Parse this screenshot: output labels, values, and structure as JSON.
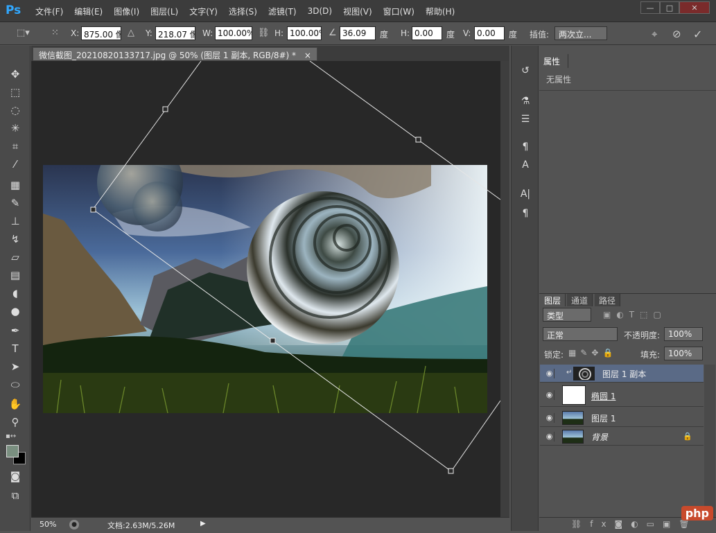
{
  "app": {
    "logo": "Ps"
  },
  "menu": [
    "文件(F)",
    "编辑(E)",
    "图像(I)",
    "图层(L)",
    "文字(Y)",
    "选择(S)",
    "滤镜(T)",
    "3D(D)",
    "视图(V)",
    "窗口(W)",
    "帮助(H)"
  ],
  "window_controls": {
    "minimize": "—",
    "maximize": "□",
    "close": "✕"
  },
  "options": {
    "x_label": "X:",
    "x_value": "875.00 像",
    "y_label": "Y:",
    "y_value": "218.07 像",
    "w_label": "W:",
    "w_value": "100.00%",
    "h_label": "H:",
    "h_value": "100.00%",
    "angle_value": "36.09",
    "angle_unit": "度",
    "hskew_label": "H:",
    "hskew_value": "0.00",
    "hskew_unit": "度",
    "vskew_label": "V:",
    "vskew_value": "0.00",
    "vskew_unit": "度",
    "interp_label": "插值:",
    "interp_value": "两次立..."
  },
  "document": {
    "tab_title": "微信截图_20210820133717.jpg @ 50% (图层 1 副本, RGB/8#) *",
    "tab_close": "×"
  },
  "status": {
    "zoom": "50%",
    "doc_info": "文档:2.63M/5.26M"
  },
  "properties": {
    "tab": "属性",
    "empty_text": "无属性"
  },
  "layers_panel": {
    "tabs": [
      "图层",
      "通道",
      "路径"
    ],
    "filter_label": "类型",
    "blend_mode": "正常",
    "opacity_label": "不透明度:",
    "opacity_value": "100%",
    "lock_label": "锁定:",
    "fill_label": "填充:",
    "fill_value": "100%",
    "layers": [
      {
        "name": "图层 1 副本",
        "selected": true,
        "clipped": true
      },
      {
        "name": "椭圆 1",
        "selected": false,
        "clipped": false
      },
      {
        "name": "图层 1",
        "selected": false,
        "clipped": false
      },
      {
        "name": "背景",
        "selected": false,
        "clipped": false,
        "locked": true
      }
    ]
  },
  "watermark": "php",
  "colors": {
    "accent": "#31a8ff",
    "selected_layer": "#5a6a86"
  }
}
